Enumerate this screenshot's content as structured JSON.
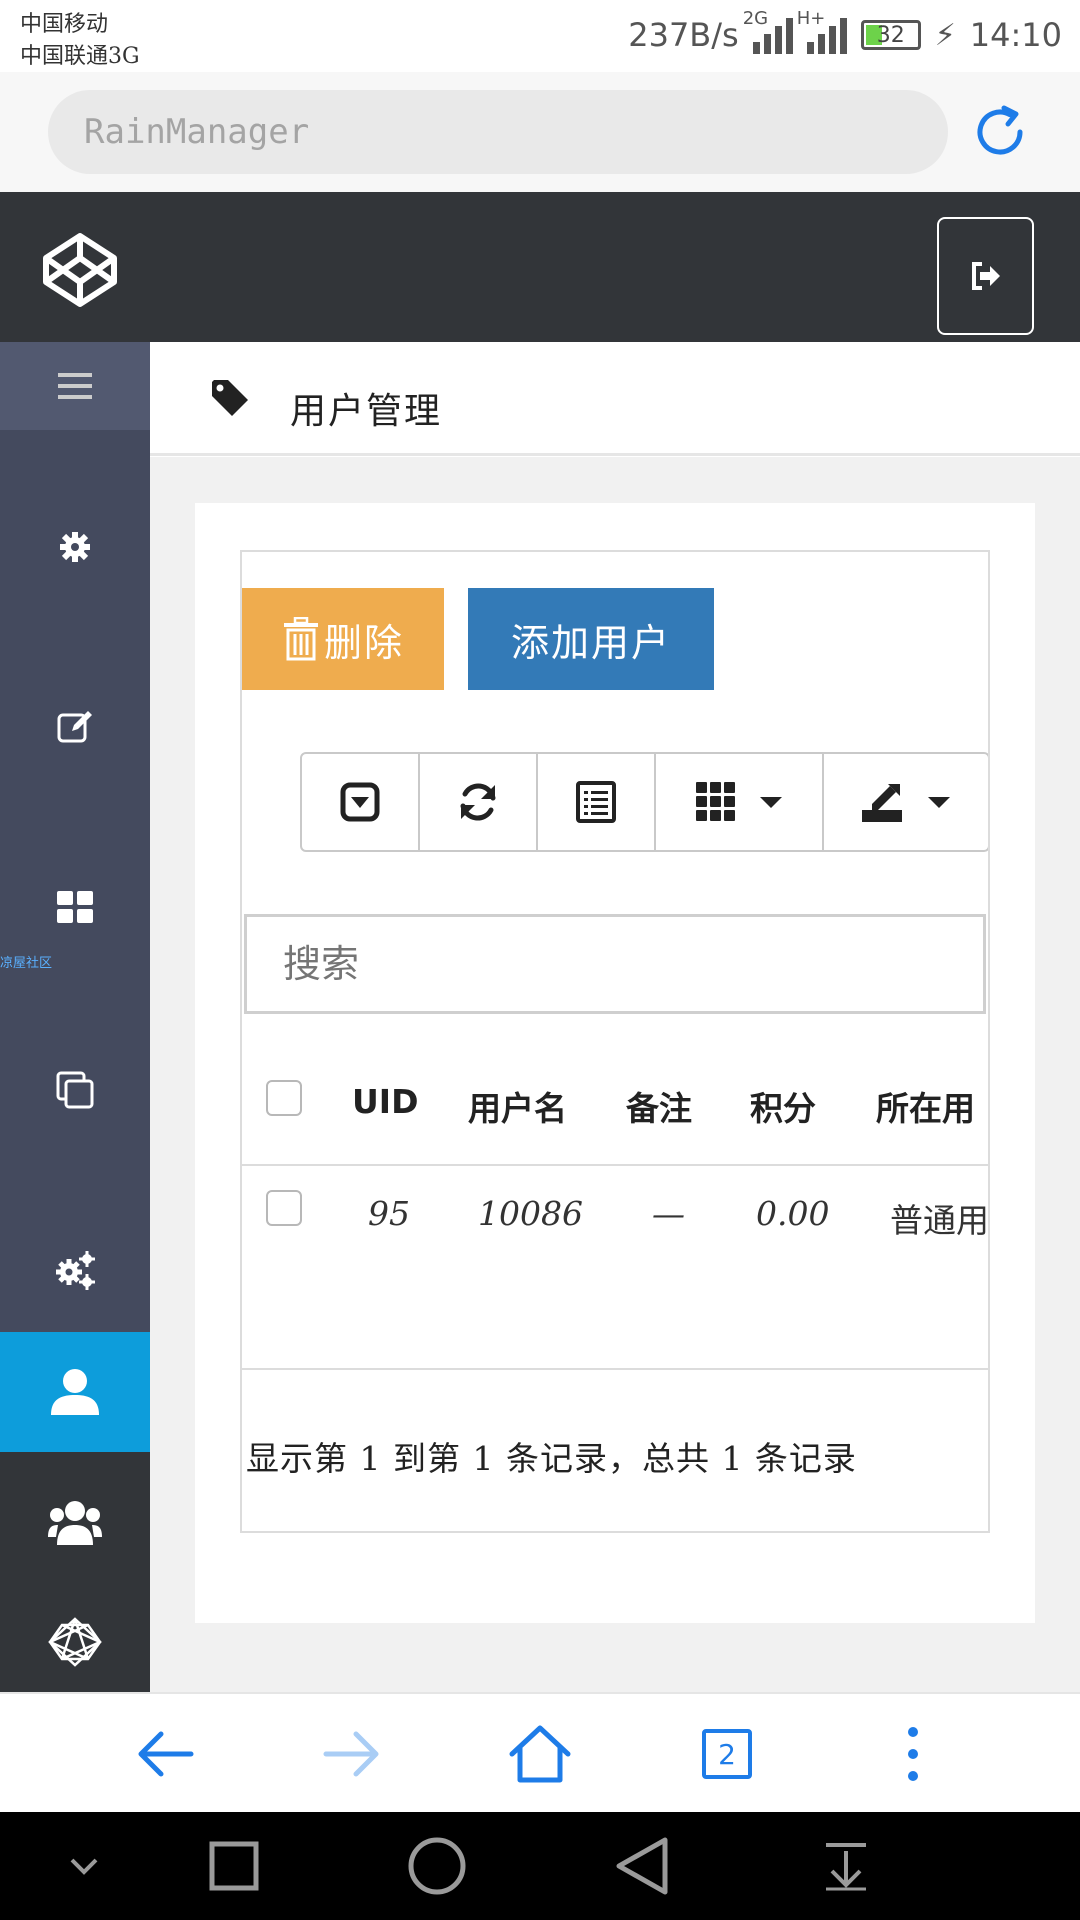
{
  "status_bar": {
    "carrier_1": "中国移动",
    "carrier_2": "中国联通3G",
    "net_speed": "237B/s",
    "signal_1_label": "2G",
    "signal_2_label": "H+",
    "battery": "32",
    "time": "14:10"
  },
  "browser": {
    "url": "RainManager",
    "tab_count": "2"
  },
  "sidebar": {
    "tooltip": "凉屋社区",
    "items": [
      "settings-icon",
      "edit-icon",
      "grid-icon",
      "copy-icon",
      "cogs-icon",
      "user-icon",
      "users-icon",
      "network-icon"
    ]
  },
  "page": {
    "title": "用户管理"
  },
  "actions": {
    "delete_label": "删除",
    "add_label": "添加用户"
  },
  "search": {
    "placeholder": "搜索"
  },
  "table": {
    "headers": [
      "UID",
      "用户名",
      "备注",
      "积分",
      "所在用"
    ],
    "rows": [
      [
        "95",
        "10086",
        "—",
        "0.00",
        "普通用"
      ]
    ]
  },
  "pagination": {
    "summary": "显示第 1 到第 1 条记录，总共 1 条记录"
  },
  "colors": {
    "header_bg": "#323539",
    "sidebar_bg": "#444a5e",
    "active_item": "#0d9ddb",
    "delete_btn": "#efac4e",
    "add_btn": "#337ab7",
    "browser_accent": "#1e7ce8"
  }
}
